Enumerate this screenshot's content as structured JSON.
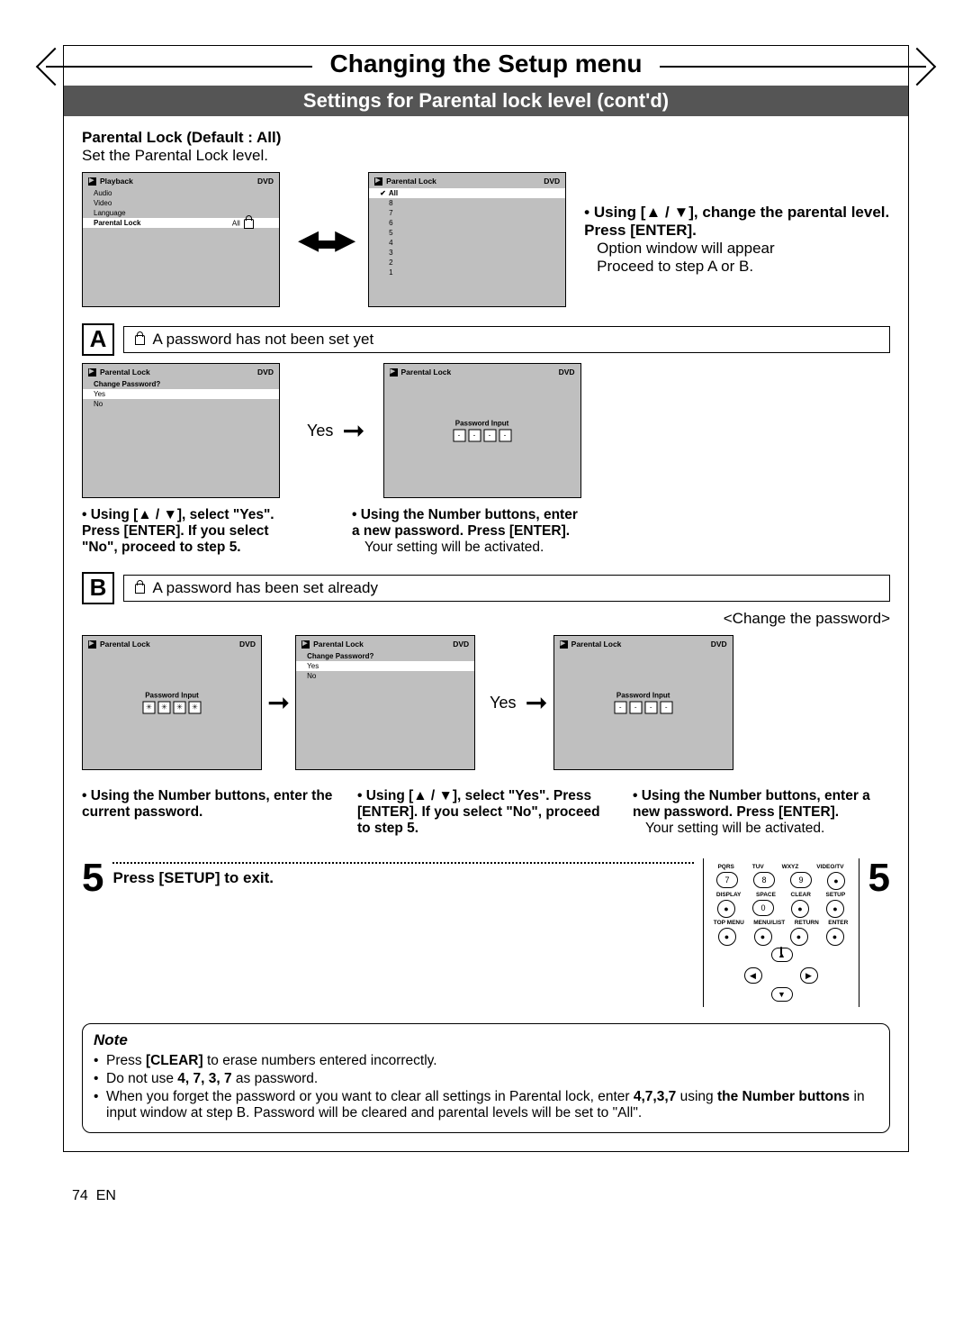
{
  "page": {
    "title": "Changing the Setup menu",
    "subtitle": "Settings for Parental lock level (cont'd)",
    "number": "74",
    "lang": "EN"
  },
  "intro": {
    "heading": "Parental Lock (Default : All)",
    "text": "Set the Parental Lock level."
  },
  "osd_playback": {
    "header": "Playback",
    "badge": "DVD",
    "rows": [
      "Audio",
      "Video",
      "Language"
    ],
    "sel_label": "Parental Lock",
    "sel_val": "All"
  },
  "osd_levels": {
    "header": "Parental Lock",
    "badge": "DVD",
    "sel": "All",
    "items": [
      "8",
      "7",
      "6",
      "5",
      "4",
      "3",
      "2",
      "1"
    ]
  },
  "instr_top": {
    "bold": "Using [▲ / ▼], change the parental level. Press [ENTER].",
    "plain1": "Option window will appear",
    "plain2": "Proceed to step A or B."
  },
  "sectionA": {
    "letter": "A",
    "title": "A password has not been set yet",
    "yes": "Yes",
    "osd_change": {
      "header": "Parental Lock",
      "badge": "DVD",
      "q": "Change Password?",
      "yes": "Yes",
      "no": "No"
    },
    "osd_pw": {
      "header": "Parental Lock",
      "badge": "DVD",
      "label": "Password Input",
      "cells": [
        "-",
        "-",
        "-",
        "-"
      ]
    },
    "left_txt": "Using [▲ / ▼], select \"Yes\". Press [ENTER]. If you select \"No\", proceed to step 5.",
    "right_txt_b": "Using the Number buttons, enter a new password. Press [ENTER].",
    "right_txt_p": "Your setting will be activated."
  },
  "sectionB": {
    "letter": "B",
    "title": "A password has been set already",
    "changepw": "<Change the password>",
    "yes": "Yes",
    "osd_pw1": {
      "header": "Parental Lock",
      "badge": "DVD",
      "label": "Password Input",
      "cells": [
        "✳",
        "✳",
        "✳",
        "✳"
      ]
    },
    "osd_change": {
      "header": "Parental Lock",
      "badge": "DVD",
      "q": "Change Password?",
      "yes": "Yes",
      "no": "No"
    },
    "osd_pw2": {
      "header": "Parental Lock",
      "badge": "DVD",
      "label": "Password Input",
      "cells": [
        "-",
        "-",
        "-",
        "-"
      ]
    },
    "c1": "Using the Number buttons, enter the current password.",
    "c2": "Using [▲ / ▼], select \"Yes\". Press [ENTER]. If you select \"No\", proceed to step 5.",
    "c3b": "Using the Number buttons, enter a new password. Press [ENTER].",
    "c3p": "Your setting will be activated."
  },
  "step5": {
    "num": "5",
    "text": "Press [SETUP] to exit.",
    "right": "5"
  },
  "remote": {
    "r1_labels": [
      "PQRS",
      "TUV",
      "WXYZ",
      "VIDEO/TV"
    ],
    "r1_btns": [
      "7",
      "8",
      "9",
      "●"
    ],
    "r2_labels": [
      "DISPLAY",
      "SPACE",
      "CLEAR",
      "SETUP"
    ],
    "r2_btns": [
      "●",
      "0",
      "●",
      "●"
    ],
    "r3_labels": [
      "TOP MENU",
      "MENU/LIST",
      "RETURN",
      "ENTER"
    ],
    "r3_btns": [
      "●",
      "●",
      "●",
      "●"
    ],
    "dpad": {
      "up": "▲",
      "down": "▼",
      "left": "◀",
      "right": "▶"
    }
  },
  "note": {
    "header": "Note",
    "l1a": "Press ",
    "l1b": "[CLEAR]",
    "l1c": " to erase numbers entered incorrectly.",
    "l2a": "Do not use ",
    "l2b": "4, 7, 3, 7",
    "l2c": " as password.",
    "l3a": "When you forget the password or you want to clear all settings in Parental lock, enter ",
    "l3b": "4,7,3,7",
    "l3c": " using ",
    "l3d": "the Number buttons",
    "l3e": " in input window at step B. Password will be cleared and parental levels will be set to \"All\"."
  }
}
